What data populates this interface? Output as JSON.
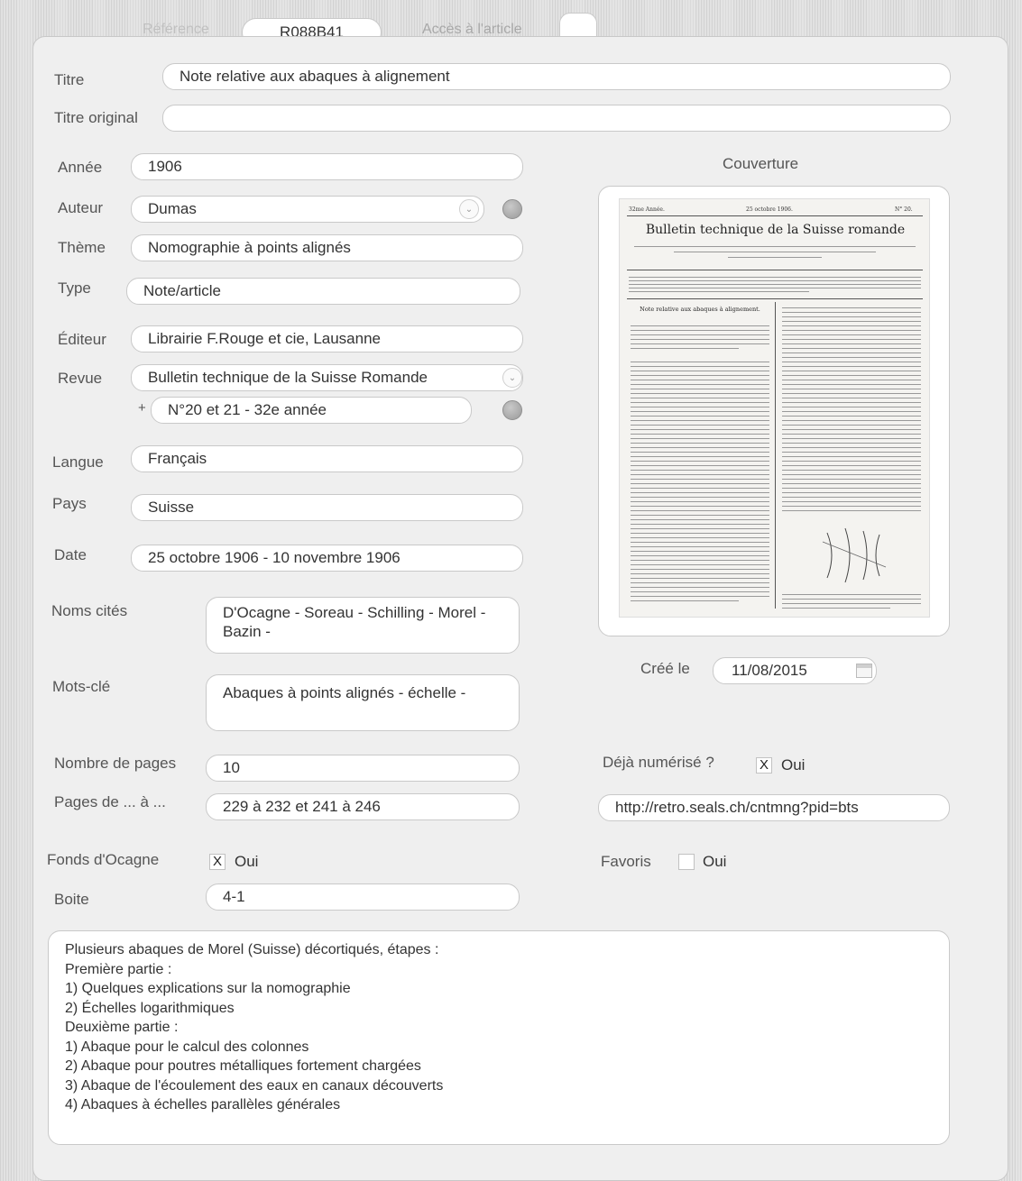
{
  "tabs": {
    "ref_label": "Référence",
    "ref_value": "R088B41",
    "access_label": "Accès à l'article"
  },
  "fields": {
    "titre": {
      "label": "Titre",
      "value": "Note relative aux abaques à alignement"
    },
    "titre_original": {
      "label": "Titre original",
      "value": ""
    },
    "annee": {
      "label": "Année",
      "value": "1906"
    },
    "auteur": {
      "label": "Auteur",
      "value": "Dumas"
    },
    "theme": {
      "label": "Thème",
      "value": "Nomographie à points alignés"
    },
    "type": {
      "label": "Type",
      "value": "Note/article"
    },
    "editeur": {
      "label": "Éditeur",
      "value": "Librairie F.Rouge et cie, Lausanne"
    },
    "revue": {
      "label": "Revue",
      "value": "Bulletin technique de la Suisse Romande"
    },
    "numero": {
      "plus": "+",
      "value": "N°20 et 21 - 32e année"
    },
    "langue": {
      "label": "Langue",
      "value": "Français"
    },
    "pays": {
      "label": "Pays",
      "value": "Suisse"
    },
    "date": {
      "label": "Date",
      "value": "25 octobre 1906 - 10 novembre 1906"
    },
    "noms_cites": {
      "label": "Noms cités",
      "value": "D'Ocagne - Soreau - Schilling - Morel - Bazin -"
    },
    "mots_cle": {
      "label": "Mots-clé",
      "value": "Abaques à points alignés - échelle -"
    },
    "nombre_pages": {
      "label": "Nombre de pages",
      "value": "10"
    },
    "pages": {
      "label": "Pages de ... à ...",
      "value": "229 à 232 et 241 à 246"
    },
    "fonds": {
      "label": "Fonds d'Ocagne",
      "check": "X",
      "option": "Oui"
    },
    "boite": {
      "label": "Boite",
      "value": "4-1"
    },
    "couverture": {
      "label": "Couverture"
    },
    "cree_le": {
      "label": "Créé le",
      "value": "11/08/2015"
    },
    "numerise": {
      "label": "Déjà numérisé ?",
      "check": "X",
      "option": "Oui"
    },
    "url": {
      "value": "http://retro.seals.ch/cntmng?pid=bts"
    },
    "favoris": {
      "label": "Favoris",
      "check": "",
      "option": "Oui"
    }
  },
  "cover_doc": {
    "header_left": "32me Année.",
    "header_mid": "25 octobre 1906.",
    "header_right": "N° 20.",
    "title": "Bulletin technique de la Suisse romande",
    "article_title": "Note relative aux abaques à alignement."
  },
  "notes": [
    "Plusieurs abaques de Morel (Suisse) décortiqués, étapes :",
    "Première partie :",
    "1) Quelques explications sur la nomographie",
    "2) Échelles logarithmiques",
    "Deuxième partie :",
    "1) Abaque pour le calcul des colonnes",
    "2) Abaque pour poutres métalliques fortement chargées",
    "3) Abaque de l'écoulement des eaux en canaux découverts",
    "4) Abaques à échelles parallèles générales"
  ],
  "icons": {
    "dropdown": "chevron-down-icon",
    "status": "status-dot-icon",
    "calendar": "calendar-icon"
  }
}
